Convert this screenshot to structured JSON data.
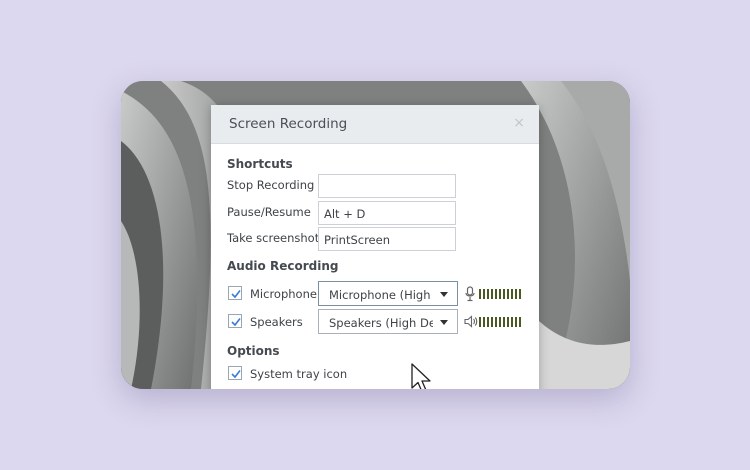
{
  "dialog": {
    "title": "Screen Recording",
    "close_glyph": "×",
    "shortcuts": {
      "heading": "Shortcuts",
      "stop_label": "Stop Recording",
      "stop_value": "",
      "pause_label": "Pause/Resume",
      "pause_value": "Alt + D",
      "screenshot_label": "Take screenshot",
      "screenshot_value": "PrintScreen"
    },
    "audio": {
      "heading": "Audio Recording",
      "microphone": {
        "label": "Microphone",
        "checked": true,
        "device": "Microphone (High D",
        "icon": "microphone-icon"
      },
      "speakers": {
        "label": "Speakers",
        "checked": true,
        "device": "Speakers (High Defir",
        "icon": "speaker-icon"
      }
    },
    "options": {
      "heading": "Options",
      "tray": {
        "label": "System tray icon",
        "checked": true
      }
    }
  },
  "colors": {
    "page_bg": "#dcd8ef",
    "check_accent": "#3a7bd5",
    "level_bars": "#4a5a20"
  }
}
